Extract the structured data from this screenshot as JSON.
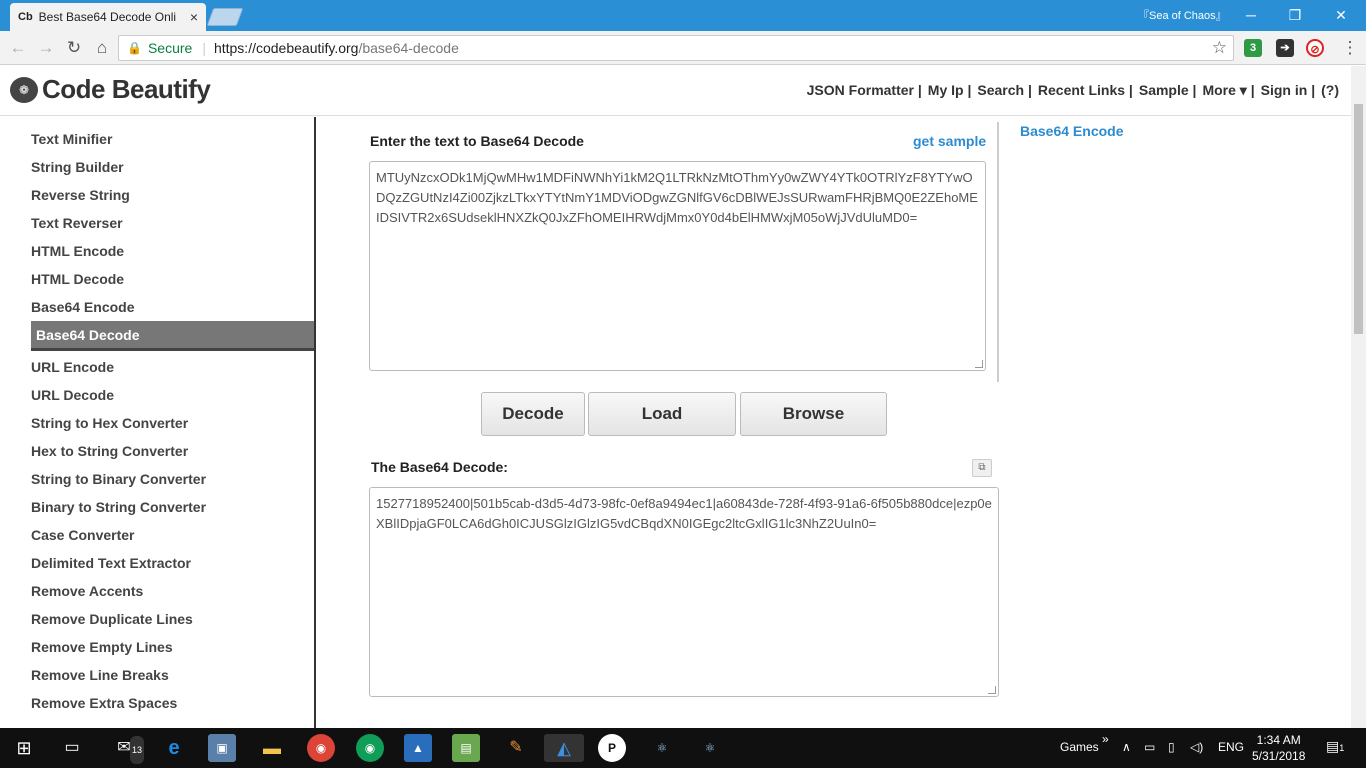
{
  "browser": {
    "tab_title": "Best Base64 Decode Onli",
    "tab_favicon": "Cb",
    "tab_close": "×",
    "window_title": "『Sea of Chaos』",
    "secure_label": "Secure",
    "url_host": "https://codebeautify.org",
    "url_path": "/base64-decode",
    "ext_badge": "3"
  },
  "site": {
    "logo": "Code Beautify",
    "nav": [
      "JSON Formatter |",
      "My Ip |",
      "Search |",
      "Recent Links |",
      "Sample |",
      "More ▾ |",
      "Sign in |",
      "(?)"
    ]
  },
  "sidebar": {
    "items_before": [
      "Text Minifier",
      "String Builder",
      "Reverse String",
      "Text Reverser",
      "HTML Encode",
      "HTML Decode",
      "Base64 Encode"
    ],
    "active": "Base64 Decode",
    "items_after": [
      "URL Encode",
      "URL Decode",
      "String to Hex Converter",
      "Hex to String Converter",
      "String to Binary Converter",
      "Binary to String Converter",
      "Case Converter",
      "Delimited Text Extractor",
      "Remove Accents",
      "Remove Duplicate Lines",
      "Remove Empty Lines",
      "Remove Line Breaks",
      "Remove Extra Spaces"
    ]
  },
  "main": {
    "input_label": "Enter the text to Base64 Decode",
    "get_sample": "get sample",
    "input_value": "MTUyNzcxODk1MjQwMHw1MDFiNWNhYi1kM2Q1LTRkNzMtOThmYy0wZWY4YTk0OTRlYzF8YTYwODQzZGUtNzI4Zi00ZjkzLTkxYTYtNmY1MDViODgwZGNlfGV6cDBlWEJsSURwamFHRjBMQ0E2ZEhoMEIDSIVTR2x6SUdseklHNXZkQ0JxZFhOMEIHRWdjMmx0Y0d4bElHMWxjM05oWjJVdUluMD0=",
    "buttons": {
      "decode": "Decode",
      "load": "Load",
      "browse": "Browse"
    },
    "output_label": "The Base64 Decode:",
    "output_value": "1527718952400|501b5cab-d3d5-4d73-98fc-0ef8a9494ec1|a60843de-728f-4f93-91a6-6f505b880dce|ezp0eXBlIDpjaGF0LCA6dGh0ICJUSGlzIGlzIG5vdCBqdXN0IGEgc2ltcGxlIG1lc3NhZ2UuIn0="
  },
  "right": {
    "link": "Base64 Encode"
  },
  "taskbar": {
    "mail_badge": "13",
    "games": "Games",
    "lang": "ENG",
    "time": "1:34 AM",
    "date": "5/31/2018",
    "notif": "1"
  }
}
